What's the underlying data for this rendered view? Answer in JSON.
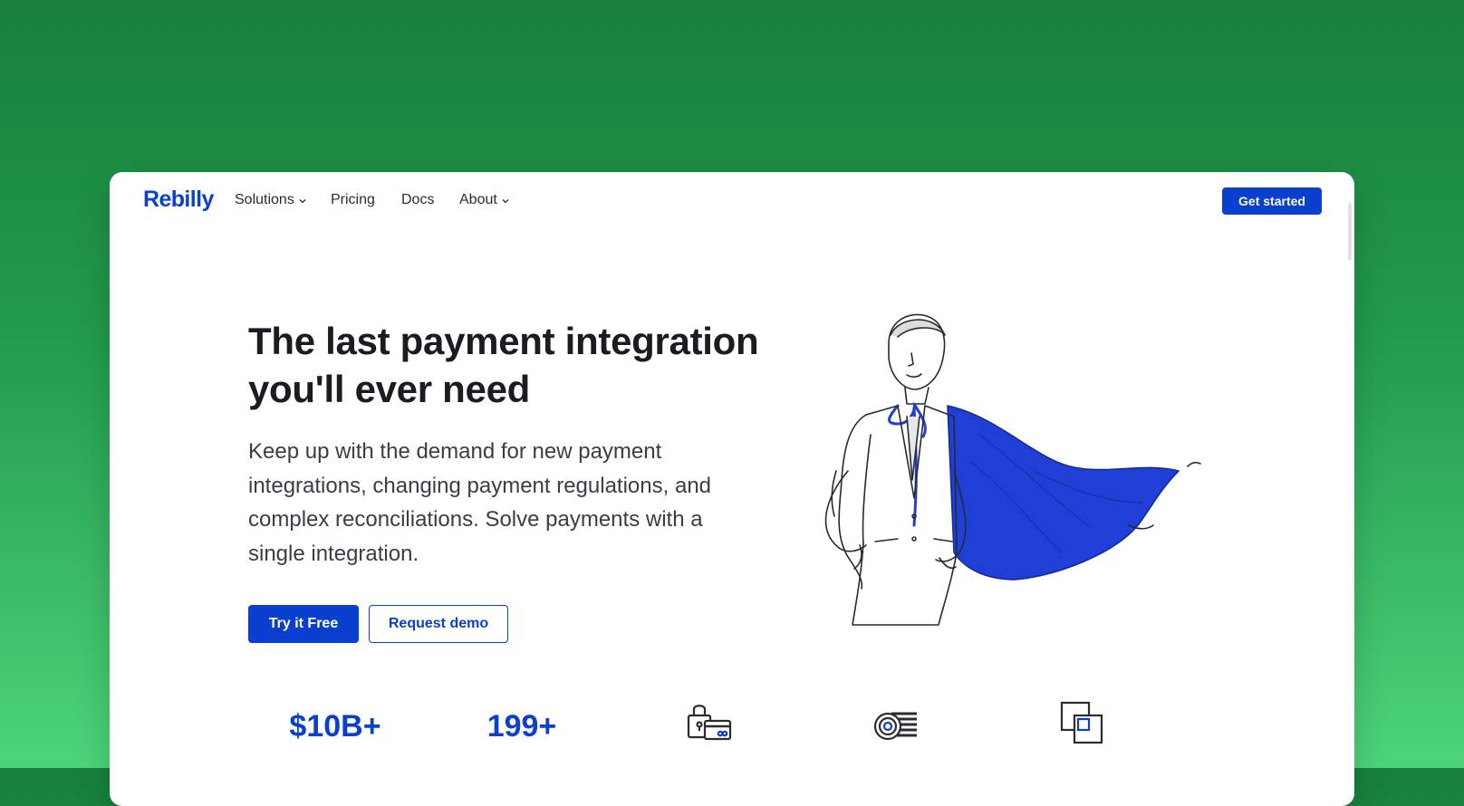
{
  "brand": {
    "logo_text": "Rebilly",
    "accent_color": "#0a3fd0",
    "background_color": "#239c4d"
  },
  "nav": {
    "items": [
      {
        "label": "Solutions",
        "has_dropdown": true
      },
      {
        "label": "Pricing",
        "has_dropdown": false
      },
      {
        "label": "Docs",
        "has_dropdown": false
      },
      {
        "label": "About",
        "has_dropdown": true
      }
    ],
    "cta_label": "Get started"
  },
  "hero": {
    "title": "The last payment integration you'll ever need",
    "subtitle": "Keep up with the demand for new payment integrations, changing payment regulations, and complex reconciliations. Solve payments with a single integration.",
    "primary_cta": "Try it Free",
    "secondary_cta": "Request demo",
    "illustration": "businessman-with-blue-cape-illustration"
  },
  "stats": [
    {
      "value": "$10B+"
    },
    {
      "value": "199+"
    }
  ],
  "feature_icons": [
    "secure-card-icon",
    "coins-gear-icon",
    "overlapping-squares-icon"
  ]
}
